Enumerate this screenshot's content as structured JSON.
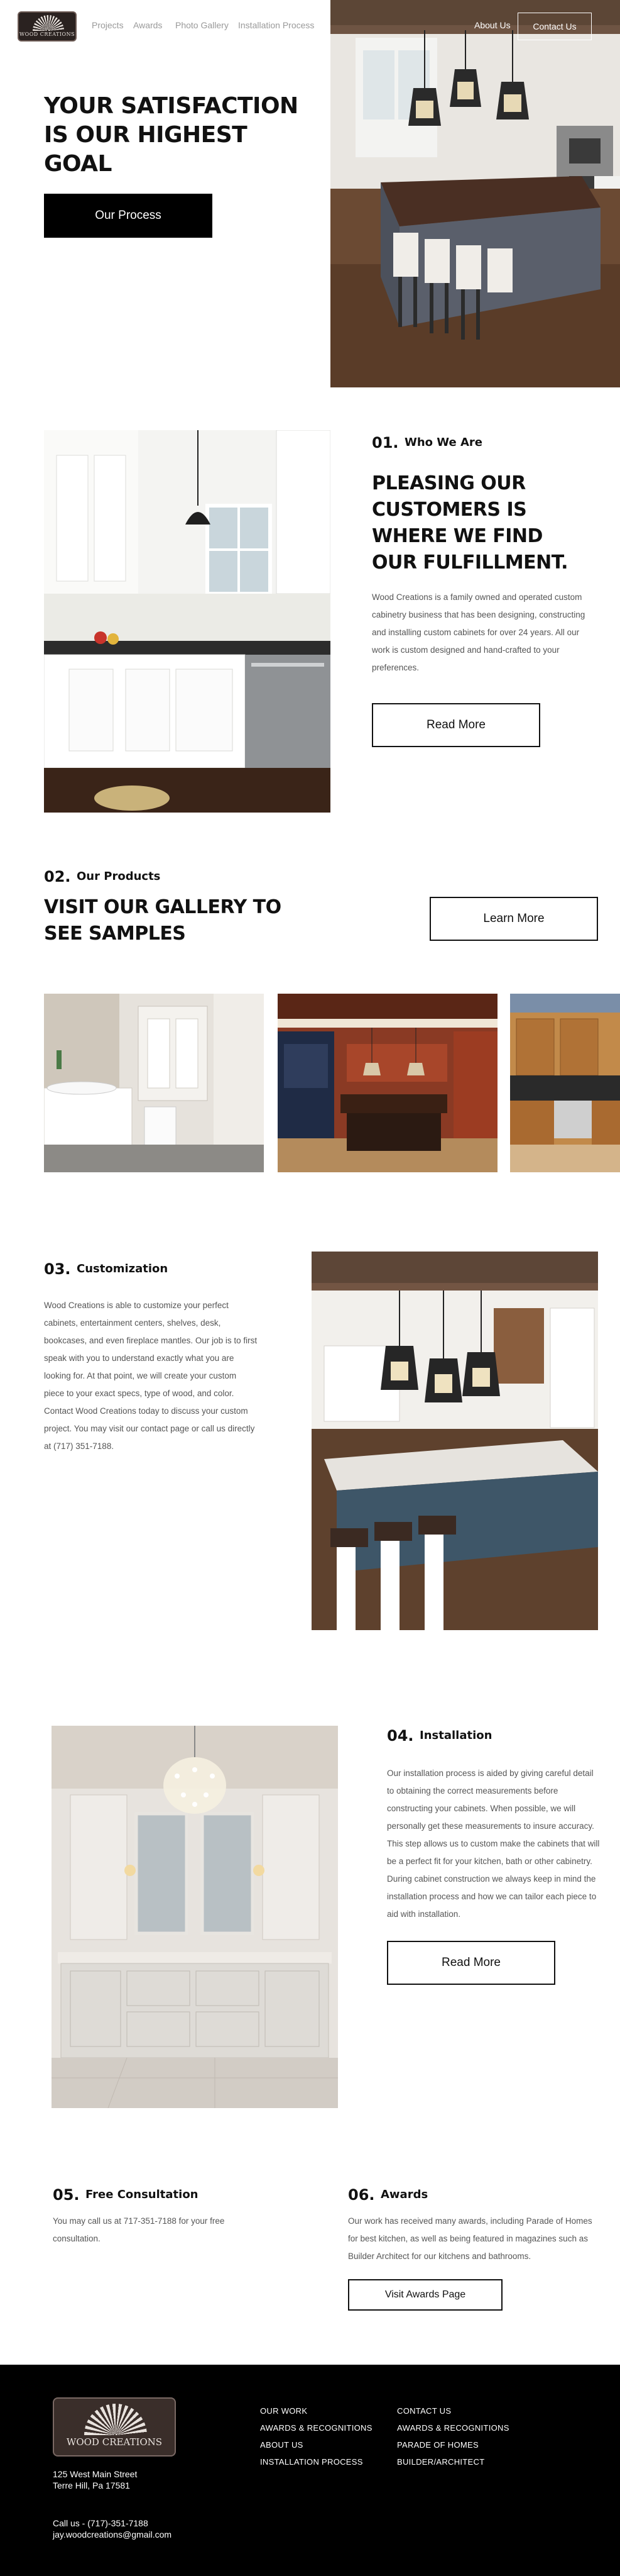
{
  "header": {
    "logo_text": "WOOD CREATIONS",
    "nav": [
      "Projects",
      "Awards",
      "Photo Gallery",
      "Installation Process"
    ],
    "about_label": "About Us",
    "contact_label": "Contact Us"
  },
  "hero": {
    "title": "YOUR SATISFACTION IS OUR HIGHEST GOAL",
    "button": "Our Process"
  },
  "who": {
    "num": "01.",
    "label": "Who We Are",
    "title": "PLEASING OUR CUSTOMERS IS WHERE WE FIND OUR FULFILLMENT.",
    "body": "Wood Creations is a family owned and operated custom cabinetry business that has been designing, constructing and installing custom cabinets for over 24 years. All our work is custom designed and hand-crafted to your preferences.",
    "button": "Read More"
  },
  "products": {
    "num": "02.",
    "label": "Our Products",
    "title": "VISIT OUR GALLERY TO SEE SAMPLES",
    "button": "Learn More"
  },
  "custom": {
    "num": "03.",
    "label": "Customization",
    "body": "Wood Creations is able to customize your perfect cabinets, entertainment centers, shelves, desk, bookcases, and even fireplace mantles. Our job is to first speak with you to understand exactly what you are looking for. At that point, we will create your custom piece to your exact specs, type of wood, and color. Contact Wood Creations today to discuss your custom project. You may visit our contact page or call us directly at (717) 351-7188."
  },
  "install": {
    "num": "04.",
    "label": "Installation",
    "body": "Our installation process is aided by giving careful detail to obtaining the correct measurements before constructing your cabinets. When possible, we will personally get these measurements to insure accuracy. This step allows us to custom make the cabinets that will be a perfect fit for your kitchen, bath or other cabinetry. During cabinet construction we always keep in mind the installation process and how we can tailor each piece to aid with installation.",
    "button": "Read More"
  },
  "consult": {
    "num": "05.",
    "label": "Free Consultation",
    "body": "You may call us at 717-351-7188 for your free consultation."
  },
  "awards": {
    "num": "06.",
    "label": "Awards",
    "body": "Our work has received many awards, including Parade of Homes for best kitchen, as well as being featured in magazines such as Builder Architect for our kitchens and bathrooms.",
    "button": "Visit Awards Page"
  },
  "footer": {
    "logo_text": "WOOD CREATIONS",
    "address1": "125 West Main Street",
    "address2": "Terre Hill, Pa 17581",
    "phone": "Call us - (717)-351-7188",
    "email": "jay.woodcreations@gmail.com",
    "col1": [
      "OUR WORK",
      "AWARDS & RECOGNITIONS",
      "ABOUT US",
      "INSTALLATION PROCESS"
    ],
    "col2": [
      "CONTACT US",
      "AWARDS & RECOGNITIONS",
      "PARADE OF HOMES",
      "BUILDER/ARCHITECT"
    ]
  }
}
